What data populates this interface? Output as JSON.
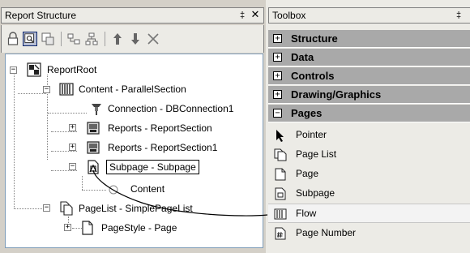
{
  "report_structure": {
    "title": "Report Structure",
    "pin": "‡",
    "close": "✕",
    "toolbar": [
      {
        "name": "lock-icon"
      },
      {
        "name": "select-object-icon",
        "selected": true
      },
      {
        "name": "select-region-icon"
      },
      {
        "name": "link-icon"
      },
      {
        "name": "hierarchy-icon"
      },
      {
        "name": "move-up-icon"
      },
      {
        "name": "move-down-icon"
      },
      {
        "name": "delete-icon"
      }
    ],
    "tree": {
      "root": "ReportRoot",
      "content": "Content - ParallelSection",
      "connection": "Connection - DBConnection1",
      "reports1": "Reports - ReportSection",
      "reports2": "Reports - ReportSection1",
      "subpage": "Subpage - Subpage",
      "subcontent": "Content",
      "pagelist": "PageList - SimplePageList",
      "pagestyle": "PageStyle - Page"
    }
  },
  "toolbox": {
    "title": "Toolbox",
    "pin": "‡",
    "categories": [
      {
        "label": "Structure",
        "state": "+"
      },
      {
        "label": "Data",
        "state": "+"
      },
      {
        "label": "Controls",
        "state": "+"
      },
      {
        "label": "Drawing/Graphics",
        "state": "+"
      },
      {
        "label": "Pages",
        "state": "−"
      }
    ],
    "tools": [
      {
        "label": "Pointer",
        "icon": "pointer-icon"
      },
      {
        "label": "Page List",
        "icon": "page-list-icon"
      },
      {
        "label": "Page",
        "icon": "page-icon"
      },
      {
        "label": "Subpage",
        "icon": "subpage-icon"
      },
      {
        "label": "Flow",
        "icon": "flow-icon",
        "hover": true
      },
      {
        "label": "Page Number",
        "icon": "page-number-icon"
      }
    ]
  },
  "colors": {
    "category_header": "#a9a9a9",
    "panel_bg": "#ecebe6",
    "selection_border": "#0a246a"
  }
}
